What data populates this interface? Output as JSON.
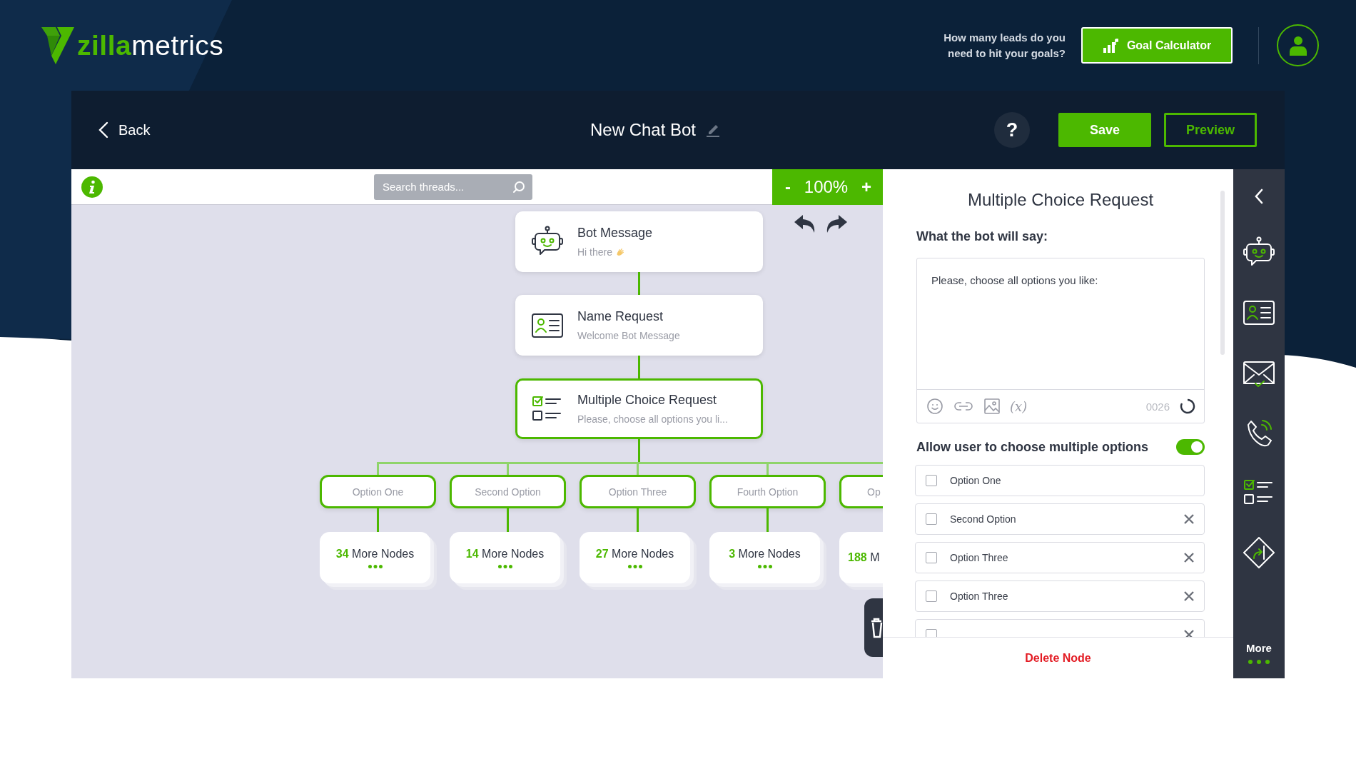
{
  "header": {
    "logo_text": "**zilla**metrics",
    "prompt": "How many leads do you need to hit your goals?",
    "goal_button": "Goal Calculator"
  },
  "toolbar": {
    "back": "Back",
    "title": "New Chat Bot",
    "help": "?",
    "save": "Save",
    "preview": "Preview"
  },
  "canvas": {
    "search": {
      "placeholder": "Search threads..."
    },
    "zoom": {
      "minus": "-",
      "value": "100%",
      "plus": "+"
    },
    "nodes": [
      {
        "kind": "bot",
        "title": "Bot Message",
        "subtitle": "Hi there",
        "wave_emoji": true,
        "selected": false
      },
      {
        "kind": "contact",
        "title": "Name Request",
        "subtitle": "Welcome Bot Message",
        "wave_emoji": false,
        "selected": false
      },
      {
        "kind": "choice",
        "title": "Multiple Choice Request",
        "subtitle": "Please, choose all options you li...",
        "wave_emoji": false,
        "selected": true
      }
    ],
    "options": [
      {
        "label": "Option One",
        "count": "34",
        "more": "More Nodes"
      },
      {
        "label": "Second Option",
        "count": "14",
        "more": "More Nodes"
      },
      {
        "label": "Option Three",
        "count": "27",
        "more": "More Nodes"
      },
      {
        "label": "Fourth Option",
        "count": "3",
        "more": "More Nodes"
      },
      {
        "label": "Op",
        "count": "188",
        "more": "M"
      }
    ]
  },
  "panel": {
    "title": "Multiple Choice Request",
    "prompt_label": "What the bot will say:",
    "message": "Please, choose all options you like:",
    "variable_label": "(x)",
    "char_count": "0026",
    "multi_toggle": {
      "label": "Allow user to choose multiple options",
      "on": true
    },
    "options": [
      {
        "label": "Option One",
        "checked": false,
        "removable": false
      },
      {
        "label": "Second Option",
        "checked": false,
        "removable": true
      },
      {
        "label": "Option Three",
        "checked": false,
        "removable": true
      },
      {
        "label": "Option Three",
        "checked": false,
        "removable": true
      },
      {
        "checked": false,
        "removable": true
      }
    ],
    "delete": "Delete Node"
  },
  "sidebar": {
    "tools": [
      {
        "kind": "bot"
      },
      {
        "kind": "contact"
      },
      {
        "kind": "email"
      },
      {
        "kind": "phone"
      },
      {
        "kind": "choice"
      },
      {
        "kind": "condition"
      }
    ],
    "more": "More"
  }
}
